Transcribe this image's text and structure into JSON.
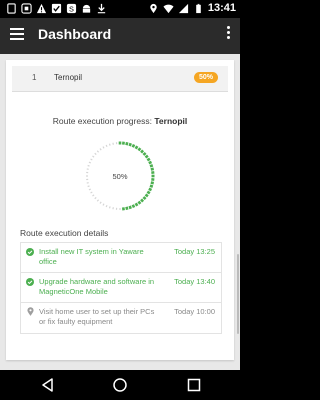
{
  "status_bar": {
    "time": "13:41",
    "left_icons": [
      "sim-icon",
      "notification-icon",
      "warning-icon",
      "checkbox-icon",
      "app-icon",
      "android-icon",
      "download-icon"
    ],
    "right_icons": [
      "location-icon",
      "wifi-icon",
      "signal-icon",
      "battery-icon"
    ]
  },
  "app_bar": {
    "title": "Dashboard"
  },
  "route": {
    "number": "1",
    "name": "Ternopil",
    "progress_badge": "50%"
  },
  "progress": {
    "label": "Route execution progress:",
    "route_name": "Ternopil",
    "percent_text": "50%",
    "percent_value": 0.5
  },
  "details": {
    "title": "Route execution details",
    "items": [
      {
        "text": "Install new IT system in Yaware office",
        "time": "Today 13:25",
        "status": "done"
      },
      {
        "text": "Upgrade hardware and software in MagneticOne Mobile",
        "time": "Today 13:40",
        "status": "done"
      },
      {
        "text": "Visit home user to set up their PCs or fix faulty equipment",
        "time": "Today 10:00",
        "status": "pending"
      }
    ]
  },
  "colors": {
    "accent_green": "#4caf50",
    "badge_orange": "#f5a623",
    "app_bar": "#2b2b2b"
  }
}
